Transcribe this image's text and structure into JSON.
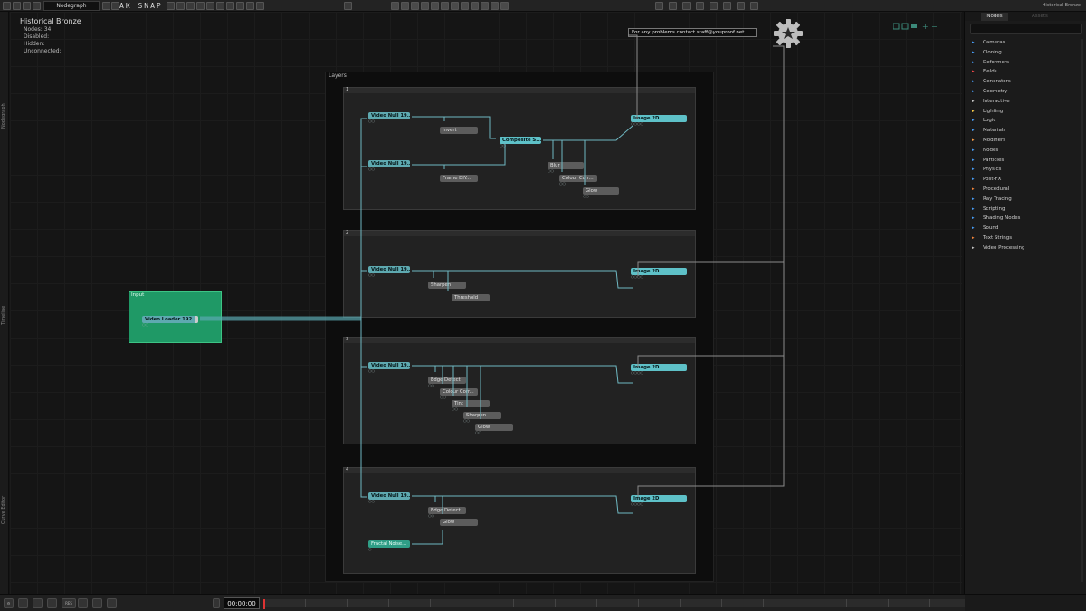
{
  "toolbar": {
    "tab_label": "Nodegraph",
    "snap_label": "AK SNAP",
    "right_title": "Historical Bronze"
  },
  "left_tabs": [
    "Nodegraph",
    "Timeline",
    "Curve Editor"
  ],
  "project": {
    "title": "Historical Bronze",
    "stats": [
      "Nodes: 34",
      "Disabled:",
      "Hidden:",
      "Unconnected:"
    ]
  },
  "contact_text": "For  any  problems  contact  staff@youproof.net",
  "layers_group": {
    "label": "Layers",
    "layers": [
      {
        "number": "1",
        "nodes": {
          "video_a": "Video Null 19...",
          "invert": "Invert",
          "video_b": "Video Null 19...",
          "frame": "Frame DIY...",
          "composite": "Composite S...",
          "blur": "Blur",
          "colour": "Colour Corr...",
          "glow": "Glow",
          "image": "Image 2D"
        }
      },
      {
        "number": "2",
        "nodes": {
          "video": "Video Null 19...",
          "sharpen": "Sharpen",
          "threshold": "Threshold",
          "image": "Image 2D"
        }
      },
      {
        "number": "3",
        "nodes": {
          "video": "Video Null 19...",
          "edge": "Edge Detect",
          "colour": "Colour Corr...",
          "tint": "Tint",
          "sharpen": "Sharpen",
          "glow": "Glow",
          "image": "Image 2D"
        }
      },
      {
        "number": "4",
        "nodes": {
          "video": "Video Null 19...",
          "edge": "Edge Detect",
          "glow": "Glow",
          "noise": "Fractal Noise...",
          "image": "Image 2D"
        }
      }
    ]
  },
  "input_group": {
    "label": "Input",
    "node": "Video Loader 192..."
  },
  "right_panel": {
    "tab_label": "Nodes",
    "tab2_label": "Assets",
    "items": [
      {
        "label": "Cameras",
        "color": "#4aa3ff"
      },
      {
        "label": "Cloning",
        "color": "#4aa3ff"
      },
      {
        "label": "Deformers",
        "color": "#4aa3ff"
      },
      {
        "label": "Fields",
        "color": "#ff4a4a"
      },
      {
        "label": "Generators",
        "color": "#4aa3ff"
      },
      {
        "label": "Geometry",
        "color": "#4aa3ff"
      },
      {
        "label": "Interactive",
        "color": "#cccccc"
      },
      {
        "label": "Lighting",
        "color": "#ffd24a"
      },
      {
        "label": "Logic",
        "color": "#4aa3ff"
      },
      {
        "label": "Materials",
        "color": "#4aa3ff"
      },
      {
        "label": "Modifiers",
        "color": "#ffa24a"
      },
      {
        "label": "Nodes",
        "color": "#4aa3ff"
      },
      {
        "label": "Particles",
        "color": "#4aa3ff"
      },
      {
        "label": "Physics",
        "color": "#4aa3ff"
      },
      {
        "label": "Post-FX",
        "color": "#4aa3ff"
      },
      {
        "label": "Procedural",
        "color": "#ff8a3a"
      },
      {
        "label": "Ray Tracing",
        "color": "#4aa3ff"
      },
      {
        "label": "Scripting",
        "color": "#4aa3ff"
      },
      {
        "label": "Shading Nodes",
        "color": "#4aa3ff"
      },
      {
        "label": "Sound",
        "color": "#4aa3ff"
      },
      {
        "label": "Text Strings",
        "color": "#ff8a3a"
      },
      {
        "label": "Video Processing",
        "color": "#cccccc"
      }
    ]
  },
  "timeline": {
    "timecode": "00:00:00",
    "res_label": "RES"
  }
}
